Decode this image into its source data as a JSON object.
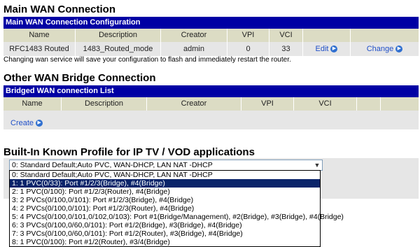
{
  "main_wan": {
    "title": "Main WAN Connection",
    "config_bar": "Main WAN Connection Configuration",
    "columns": [
      "Name",
      "Description",
      "Creator",
      "VPI",
      "VCI",
      "",
      ""
    ],
    "row": {
      "name": "RFC1483 Routed",
      "description": "1483_Routed_mode",
      "creator": "admin",
      "vpi": "0",
      "vci": "33",
      "edit_label": "Edit",
      "change_label": "Change"
    },
    "note": "Changing wan service will save your configuration to flash and immediately restart the router."
  },
  "bridge": {
    "title": "Other WAN Bridge Connection",
    "list_bar": "Bridged WAN connection List",
    "columns": [
      "Name",
      "Description",
      "Creator",
      "VPI",
      "VCI",
      "",
      ""
    ],
    "create_label": "Create"
  },
  "profiles": {
    "title": "Built-In Known Profile for IP TV / VOD applications",
    "selected": "0: Standard Default;Auto PVC, WAN-DHCP, LAN NAT -DHCP",
    "highlighted_index": 1,
    "options": [
      "0: Standard Default;Auto PVC, WAN-DHCP, LAN NAT -DHCP",
      "1: 1 PVC(0/33): Port #1/2/3(Bridge), #4(Bridge)",
      "2: 1 PVC(0/100): Port #1/2/3(Router), #4(Bridge)",
      "3: 2 PVCs(0/100,0/101): Port #1/2/3(Bridge), #4(Bridge)",
      "4: 2 PVCs(0/100,0/101): Port #1/2/3(Router), #4(Bridge)",
      "5: 4 PVCs(0/100,0/101,0/102,0/103): Port #1(Bridge/Management), #2(Bridge), #3(Bridge), #4(Bridge)",
      "6: 3 PVCs(0/100,0/60,0/101): Port #1/2(Bridge), #3(Bridge), #4(Bridge)",
      "7: 3 PVCs(0/100,0/60,0/101): Port #1/2(Router), #3(Bridge), #4(Bridge)",
      "8: 1 PVC(0/100): Port #1/2(Router), #3/4(Bridge)"
    ]
  },
  "colors": {
    "bar_blue": "#0000a4",
    "header_tan": "#dcdcc4",
    "row_grey": "#e6e6e6",
    "link_blue": "#2050c8",
    "selection_navy": "#0a246a"
  }
}
